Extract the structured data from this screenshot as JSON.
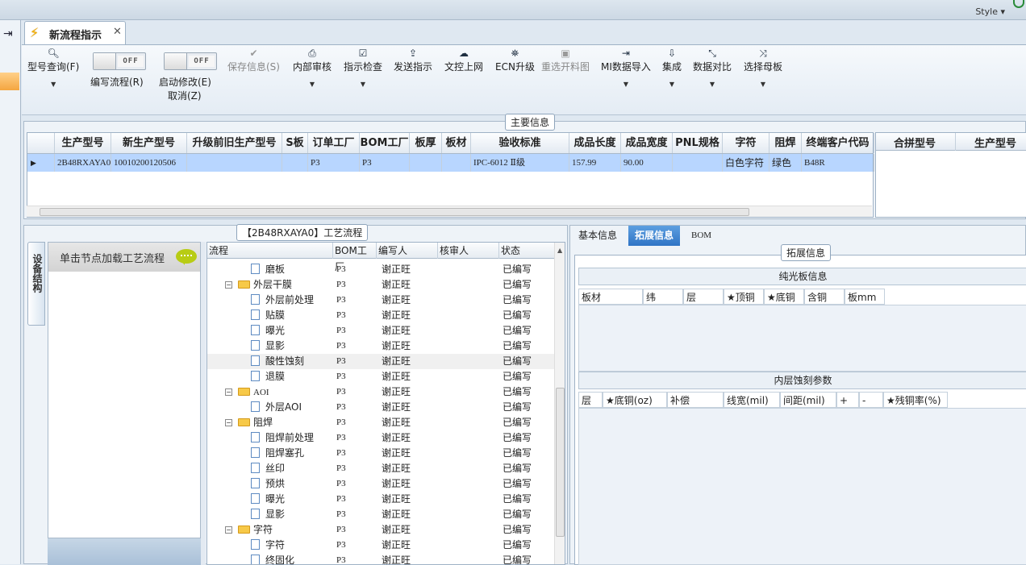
{
  "window": {
    "style_label": "Style",
    "tab_title": "新流程指示"
  },
  "toolbar": {
    "model_query": "型号查询(F)",
    "write_flow": "编写流程(R)",
    "start_modify": "启动修改(E)",
    "cancel": "取消(Z)",
    "toggle_off": "OFF",
    "save_info": "保存信息(S)",
    "internal_review": "内部审核",
    "instruction_check": "指示检查",
    "send_instruction": "发送指示",
    "doc_online": "文控上网",
    "ecn_upgrade": "ECN升级",
    "redo_cutting": "重选开料图",
    "mi_import": "MI数据导入",
    "integrate": "集成",
    "data_compare": "数据对比",
    "select_mother": "选择母板"
  },
  "main_info": {
    "section_title": "主要信息",
    "columns": [
      "生产型号",
      "新生产型号",
      "升级前旧生产型号",
      "S板",
      "订单工厂",
      "BOM工厂",
      "板厚",
      "板材",
      "验收标准",
      "成品长度",
      "成品宽度",
      "PNL规格",
      "字符",
      "阻焊",
      "终端客户代码"
    ],
    "row": [
      "2B48RXAYA0",
      "10010200120506",
      "",
      "",
      "P3",
      "P3",
      "",
      "",
      "IPC-6012 Ⅱ级",
      "157.99",
      "90.00",
      "",
      "白色字符",
      "绿色",
      "B48R"
    ],
    "right_columns": [
      "合拼型号",
      "生产型号"
    ]
  },
  "process_flow": {
    "section_title": "【2B48RXAYA0】工艺流程",
    "side_tab": "设备结构",
    "load_hint": "单击节点加载工艺流程",
    "columns": [
      "流程",
      "BOM工厂",
      "编写人",
      "核审人",
      "状态"
    ],
    "rows": [
      {
        "name": "磨板",
        "factory": "P3",
        "editor": "谢正旺",
        "status": "已编写"
      },
      {
        "name": "外层干膜",
        "factory": "P3",
        "editor": "谢正旺",
        "status": "已编写"
      },
      {
        "name": "外层前处理",
        "factory": "P3",
        "editor": "谢正旺",
        "status": "已编写"
      },
      {
        "name": "贴膜",
        "factory": "P3",
        "editor": "谢正旺",
        "status": "已编写"
      },
      {
        "name": "曝光",
        "factory": "P3",
        "editor": "谢正旺",
        "status": "已编写"
      },
      {
        "name": "显影",
        "factory": "P3",
        "editor": "谢正旺",
        "status": "已编写"
      },
      {
        "name": "酸性蚀刻",
        "factory": "P3",
        "editor": "谢正旺",
        "status": "已编写"
      },
      {
        "name": "退膜",
        "factory": "P3",
        "editor": "谢正旺",
        "status": "已编写"
      },
      {
        "name": "AOI",
        "factory": "P3",
        "editor": "谢正旺",
        "status": "已编写"
      },
      {
        "name": "外层AOI",
        "factory": "P3",
        "editor": "谢正旺",
        "status": "已编写"
      },
      {
        "name": "阻焊",
        "factory": "P3",
        "editor": "谢正旺",
        "status": "已编写"
      },
      {
        "name": "阻焊前处理",
        "factory": "P3",
        "editor": "谢正旺",
        "status": "已编写"
      },
      {
        "name": "阻焊塞孔",
        "factory": "P3",
        "editor": "谢正旺",
        "status": "已编写"
      },
      {
        "name": "丝印",
        "factory": "P3",
        "editor": "谢正旺",
        "status": "已编写"
      },
      {
        "name": "预烘",
        "factory": "P3",
        "editor": "谢正旺",
        "status": "已编写"
      },
      {
        "name": "曝光",
        "factory": "P3",
        "editor": "谢正旺",
        "status": "已编写"
      },
      {
        "name": "显影",
        "factory": "P3",
        "editor": "谢正旺",
        "status": "已编写"
      },
      {
        "name": "字符",
        "factory": "P3",
        "editor": "谢正旺",
        "status": "已编写"
      },
      {
        "name": "字符",
        "factory": "P3",
        "editor": "谢正旺",
        "status": "已编写"
      },
      {
        "name": "终固化",
        "factory": "P3",
        "editor": "谢正旺",
        "status": "已编写"
      }
    ]
  },
  "details": {
    "tabs": [
      "基本信息",
      "拓展信息",
      "BOM"
    ],
    "section_title": "拓展信息",
    "plain_board_title": "纯光板信息",
    "plain_board_cols": [
      "板材",
      "纬",
      "层",
      "★顶铜",
      "★底铜",
      "含铜",
      "板mm"
    ],
    "inner_etch_title": "内层蚀刻参数",
    "inner_etch_cols": [
      "层",
      "★底铜(oz)",
      "补偿",
      "线宽(mil)",
      "间距(mil)",
      "+",
      "-",
      "★残铜率(%)"
    ]
  }
}
